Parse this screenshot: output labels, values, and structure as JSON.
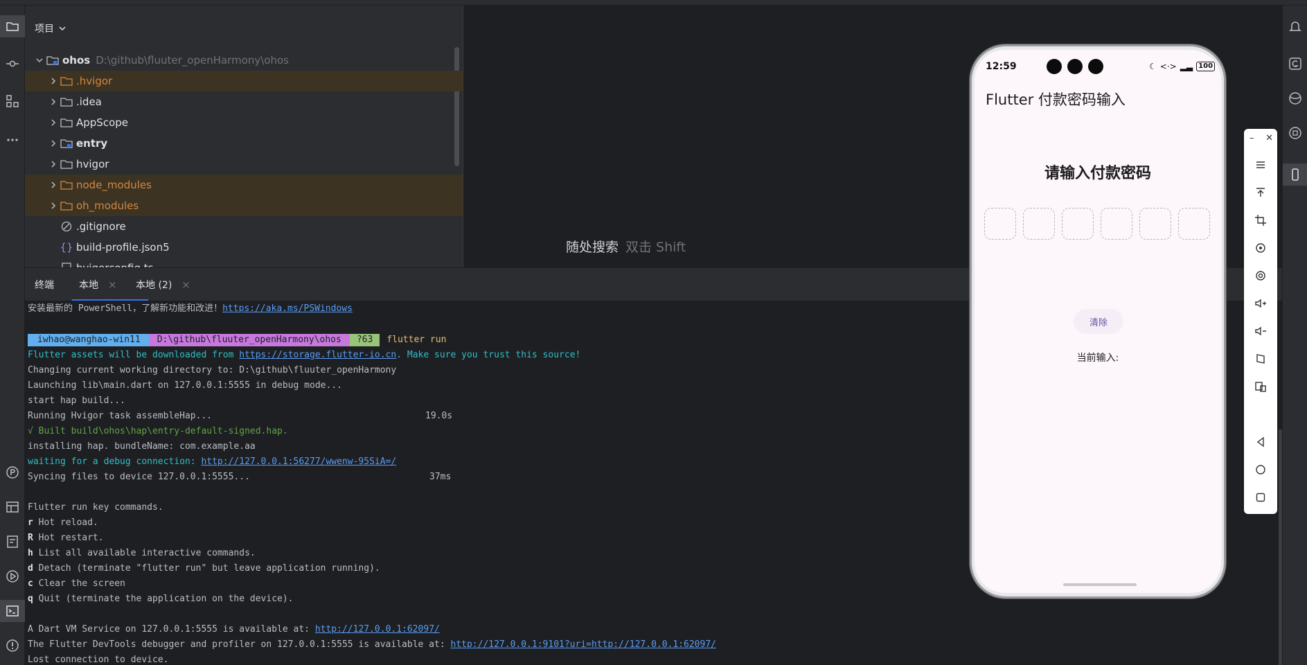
{
  "project": {
    "title": "项目",
    "root": {
      "name": "ohos",
      "path": "D:\\github\\fluuter_openHarmony\\ohos"
    },
    "items": [
      {
        "label": ".hvigor",
        "type": "folder",
        "excluded": true
      },
      {
        "label": ".idea",
        "type": "folder",
        "excluded": false
      },
      {
        "label": "AppScope",
        "type": "folder",
        "excluded": false
      },
      {
        "label": "entry",
        "type": "module",
        "excluded": false
      },
      {
        "label": "hvigor",
        "type": "folder",
        "excluded": false
      },
      {
        "label": "node_modules",
        "type": "folder",
        "excluded": true
      },
      {
        "label": "oh_modules",
        "type": "folder",
        "excluded": true
      },
      {
        "label": ".gitignore",
        "type": "file",
        "excluded": false
      },
      {
        "label": "build-profile.json5",
        "type": "json",
        "excluded": false
      },
      {
        "label": "hvigorconfig.ts",
        "type": "file",
        "excluded": false
      }
    ]
  },
  "editor": {
    "search_hint": "随处搜索",
    "search_key": "双击 Shift"
  },
  "terminal": {
    "tabs": [
      {
        "label": "终端"
      },
      {
        "label": "本地"
      },
      {
        "label": "本地 (2)"
      }
    ],
    "ps_line": "安装最新的 PowerShell，了解新功能和改进！",
    "ps_link": "https://aka.ms/PSWindows",
    "prompt": {
      "user": "iwhao@wanghao-win11",
      "path": "D:\\github\\fluuter_openHarmony\\ohos",
      "git": "?63",
      "cmd": "flutter run"
    },
    "l1a": "Flutter assets will be downloaded from ",
    "l1link": "https://storage.flutter-io.cn",
    "l1b": ". Make sure you trust this source!",
    "l2": "Changing current working directory to: D:\\github\\fluuter_openHarmony",
    "l3": "Launching lib\\main.dart on 127.0.0.1:5555 in debug mode...",
    "l4": "start hap build...",
    "l5": "Running Hvigor task assembleHap...",
    "l5t": "19.0s",
    "l6": "√ Built build\\ohos\\hap\\entry-default-signed.hap.",
    "l7": "installing hap. bundleName: com.example.aa",
    "l8a": "waiting for a debug connection: ",
    "l8link": "http://127.0.0.1:56277/wwenw-95SiA=/",
    "l9": "Syncing files to device 127.0.0.1:5555...",
    "l9t": "37ms",
    "keys_title": "Flutter run key commands.",
    "keys": [
      {
        "k": "r",
        "t": " Hot reload."
      },
      {
        "k": "R",
        "t": " Hot restart."
      },
      {
        "k": "h",
        "t": " List all available interactive commands."
      },
      {
        "k": "d",
        "t": " Detach (terminate \"flutter run\" but leave application running)."
      },
      {
        "k": "c",
        "t": " Clear the screen"
      },
      {
        "k": "q",
        "t": " Quit (terminate the application on the device)."
      }
    ],
    "vm_a": "A Dart VM Service on 127.0.0.1:5555 is available at: ",
    "vm_link": "http://127.0.0.1:62097/",
    "dt_a": "The Flutter DevTools debugger and profiler on 127.0.0.1:5555 is available at: ",
    "dt_link": "http://127.0.0.1:9101?uri=http://127.0.0.1:62097/",
    "lost": "Lost connection to device."
  },
  "phone": {
    "time": "12:59",
    "battery": "100",
    "app_title": "Flutter 付款密码输入",
    "heading": "请输入付款密码",
    "pin_count": 6,
    "clear_label": "清除",
    "current_label": "当前输入:"
  },
  "colors": {
    "accent": "#3574f0",
    "excluded": "#d3883e",
    "phone_bg": "#fdf7fb",
    "button_text": "#6750a4"
  }
}
